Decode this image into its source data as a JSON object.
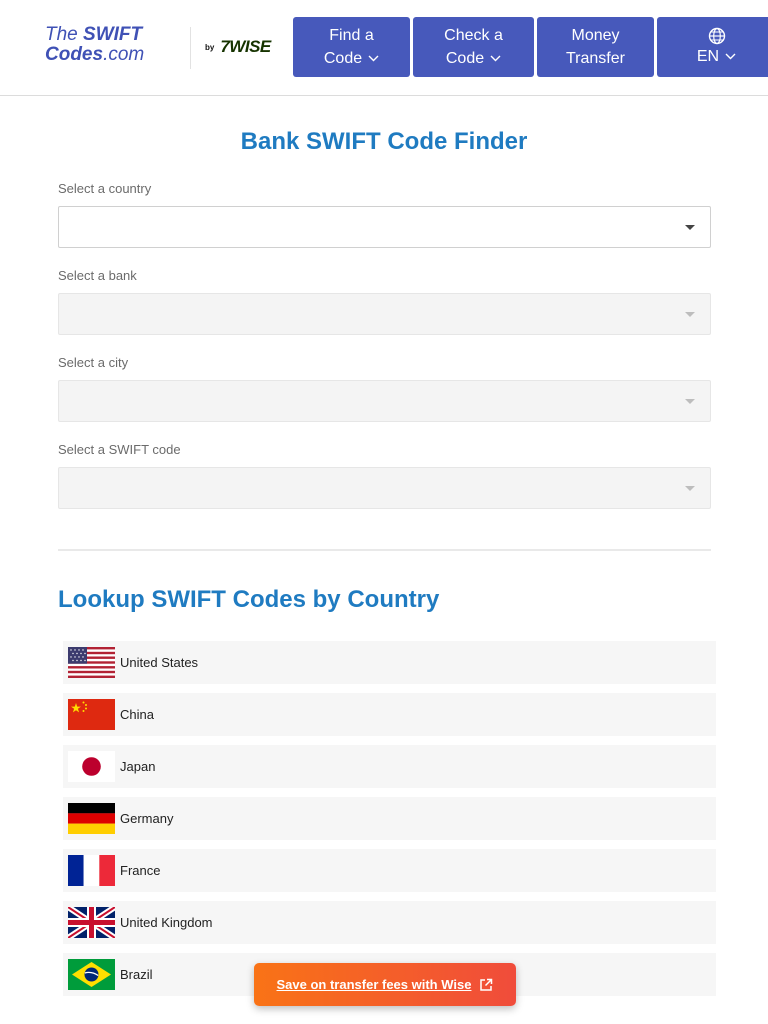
{
  "header": {
    "logo_line1_pre": "The ",
    "logo_line1_bold": "SWIFT",
    "logo_line2_bold": "Codes",
    "logo_line2_rest": ".com",
    "by": "by",
    "partner": "7WISE",
    "nav": {
      "find_line1": "Find a",
      "find_line2": "Code",
      "check_line1": "Check a",
      "check_line2": "Code",
      "money_line1": "Money",
      "money_line2": "Transfer",
      "lang": "EN"
    }
  },
  "finder": {
    "title": "Bank SWIFT Code Finder",
    "country_label": "Select a country",
    "bank_label": "Select a bank",
    "city_label": "Select a city",
    "swift_label": "Select a SWIFT code"
  },
  "lookup": {
    "title": "Lookup SWIFT Codes by Country",
    "countries": [
      {
        "name": "United States"
      },
      {
        "name": "China"
      },
      {
        "name": "Japan"
      },
      {
        "name": "Germany"
      },
      {
        "name": "France"
      },
      {
        "name": "United Kingdom"
      },
      {
        "name": "Brazil"
      }
    ]
  },
  "cta": {
    "label": "Save on transfer fees with Wise"
  },
  "colors": {
    "brand_blue": "#3f51b5",
    "nav_bg": "#4759bb",
    "heading": "#1f7bc1",
    "cta_start": "#f97316",
    "cta_end": "#f04c3b"
  }
}
